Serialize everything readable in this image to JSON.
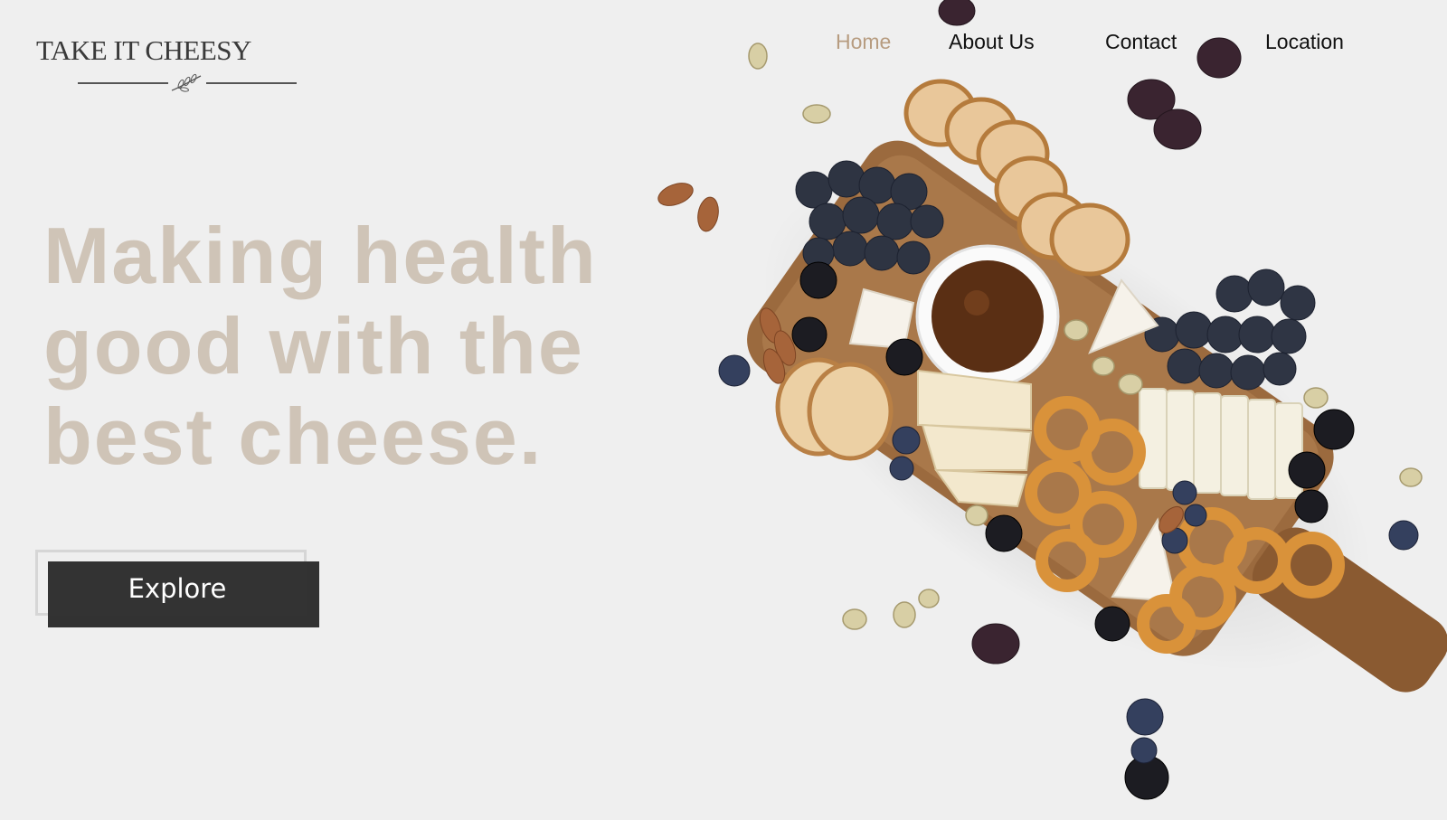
{
  "brand": {
    "name": "TAKE IT CHEESY"
  },
  "nav": {
    "items": [
      {
        "label": "Home",
        "active": true
      },
      {
        "label": "About Us",
        "active": false
      },
      {
        "label": "Contact",
        "active": false
      },
      {
        "label": "Location",
        "active": false
      }
    ]
  },
  "hero": {
    "headline_lines": [
      "Making health",
      "good with the",
      "best cheese."
    ],
    "cta_label": "Explore"
  },
  "colors": {
    "background": "#efefef",
    "nav_active": "#b79c80",
    "headline": "#cfc4b7",
    "button": "#333333"
  }
}
